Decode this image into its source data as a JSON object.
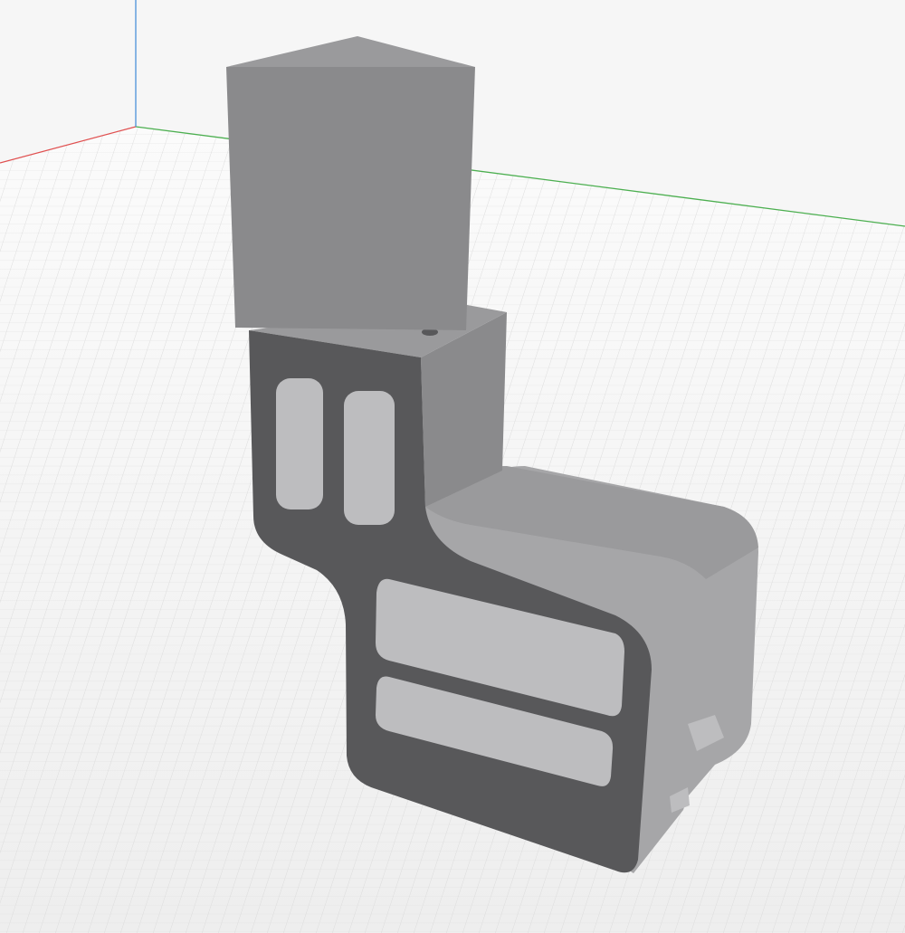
{
  "viewport": {
    "background_color": "#f6f6f6",
    "grid_color": "#d9d9d9",
    "axis_colors": {
      "x": "#e05050",
      "y": "#4caf50",
      "z": "#4a90d9"
    }
  },
  "model": {
    "colors": {
      "dark_face": "#58585a",
      "mid_face": "#8a8a8c",
      "light_face": "#a6a6a8",
      "top_face": "#9a9a9c",
      "cut_inner": "#bdbdbf"
    }
  }
}
